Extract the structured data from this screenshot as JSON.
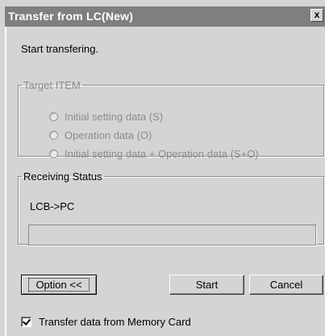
{
  "window": {
    "title": "Transfer from LC(New)",
    "close_label": "x"
  },
  "message": "Start transfering.",
  "target_group": {
    "legend": "Target ITEM",
    "disabled": true,
    "options": [
      {
        "label": "Initial setting data (S)",
        "selected": false
      },
      {
        "label": "Operation data (O)",
        "selected": false
      },
      {
        "label": "Initial setting data + Operation data (S+O)",
        "selected": false
      }
    ]
  },
  "receiving_group": {
    "legend": "Receiving Status",
    "status": "LCB->PC",
    "progress_percent": 0
  },
  "buttons": {
    "option": "Option <<",
    "start": "Start",
    "cancel": "Cancel"
  },
  "memory_card": {
    "label": "Transfer data from Memory Card",
    "checked": true
  },
  "colors": {
    "titlebar": "#7f7f7f",
    "dialog_bg": "#d4d4d4",
    "disabled_text": "#8c8c8c"
  }
}
